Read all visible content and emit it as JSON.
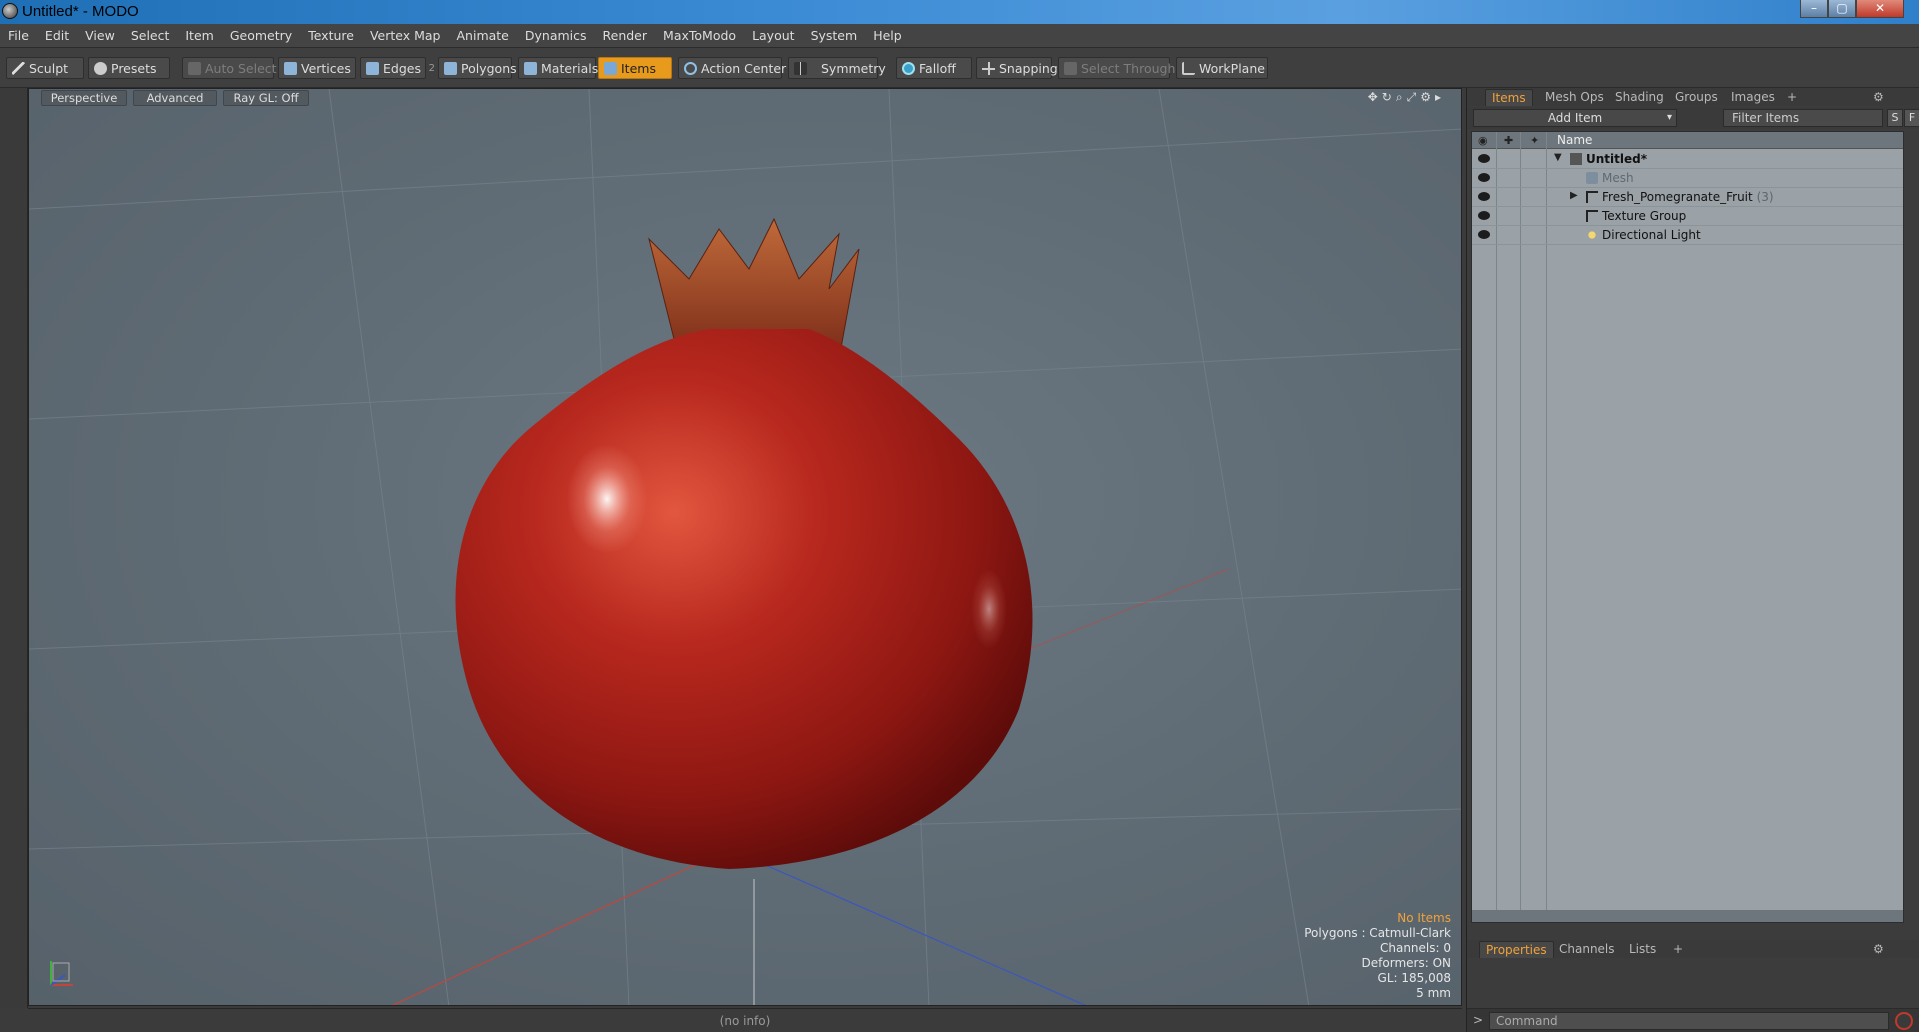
{
  "window": {
    "title": "Untitled* - MODO"
  },
  "menu": [
    "File",
    "Edit",
    "View",
    "Select",
    "Item",
    "Geometry",
    "Texture",
    "Vertex Map",
    "Animate",
    "Dynamics",
    "Render",
    "MaxToModo",
    "Layout",
    "System",
    "Help"
  ],
  "toolbar": {
    "sculpt": "Sculpt",
    "presets": "Presets",
    "auto_select": "Auto Select",
    "vertices": "Vertices",
    "edges": "Edges",
    "edges_count": "2",
    "polygons": "Polygons",
    "materials": "Materials",
    "items": "Items",
    "action_center": "Action Center",
    "symmetry": "Symmetry",
    "falloff": "Falloff",
    "snapping": "Snapping",
    "select_through": "Select Through",
    "workplane": "WorkPlane"
  },
  "viewport": {
    "tabs": [
      "Perspective",
      "Advanced",
      "Ray GL: Off"
    ],
    "info": {
      "selection": "No Items",
      "polygons": "Polygons : Catmull-Clark",
      "channels": "Channels: 0",
      "deformers": "Deformers: ON",
      "gl": "GL: 185,008",
      "unit": "5 mm"
    },
    "colors": {
      "fruit": "#b3221d",
      "highlight": "#f0a23a"
    }
  },
  "panel": {
    "tabs": [
      "Items",
      "Mesh Ops",
      "Shading",
      "Groups",
      "Images"
    ],
    "add_item": "Add Item",
    "filter_placeholder": "Filter Items",
    "s_btn": "S",
    "f_btn": "F",
    "column_name": "Name",
    "tree": [
      {
        "label": "Untitled*",
        "icon": "scene-icon",
        "count": ""
      },
      {
        "label": "Mesh",
        "icon": "mesh-icon",
        "count": ""
      },
      {
        "label": "Fresh_Pomegranate_Fruit",
        "icon": "group-icon",
        "count": "(3)"
      },
      {
        "label": "Texture Group",
        "icon": "group-icon",
        "count": ""
      },
      {
        "label": "Directional Light",
        "icon": "light-icon",
        "count": ""
      }
    ],
    "lower_tabs": [
      "Properties",
      "Channels",
      "Lists"
    ],
    "command_placeholder": "Command",
    "prompt": ">"
  },
  "statusbar": {
    "text": "(no info)"
  }
}
